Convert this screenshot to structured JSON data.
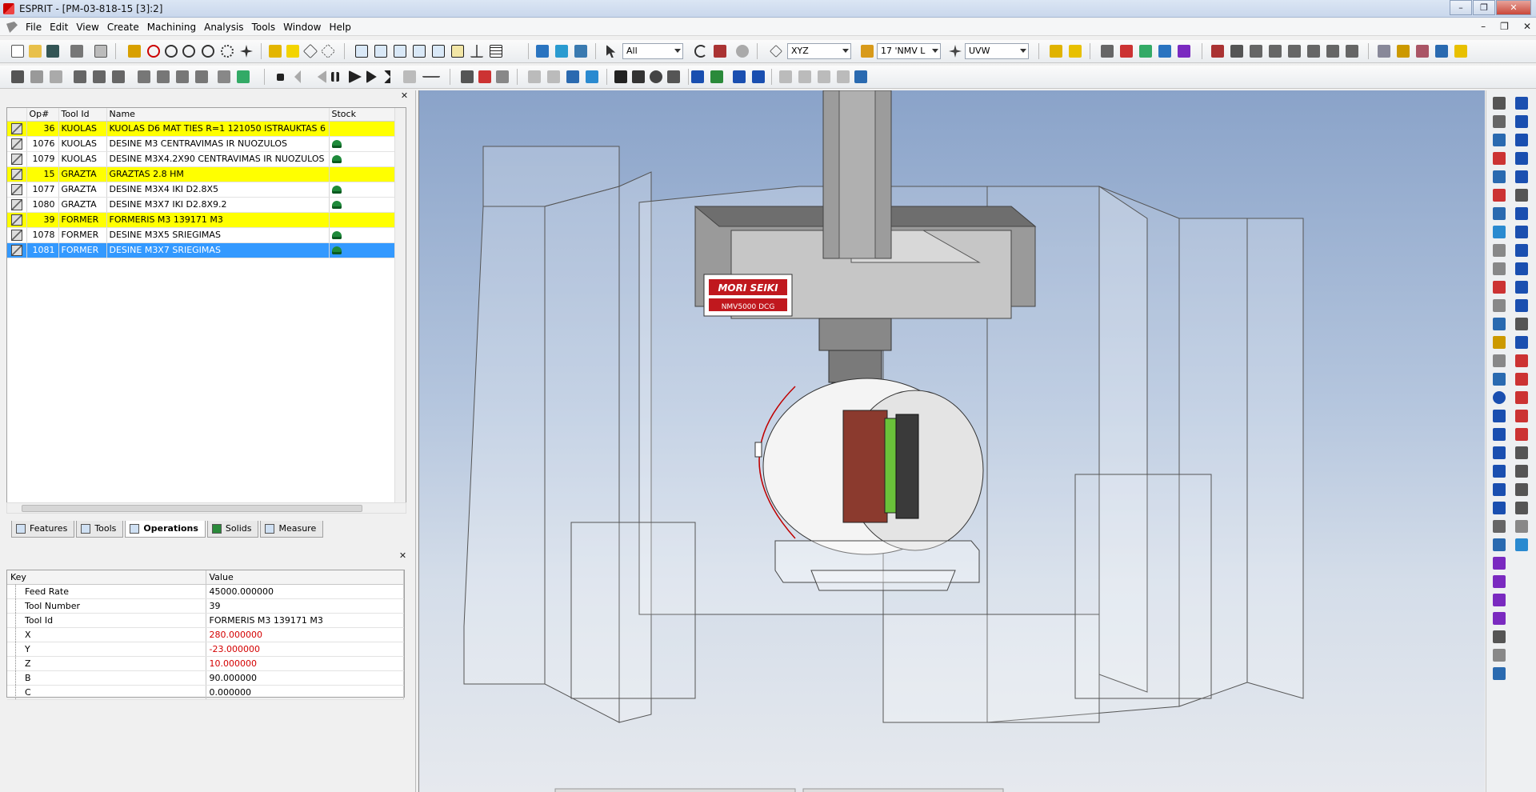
{
  "window": {
    "title": "ESPRIT - [PM-03-818-15 [3]:2]"
  },
  "menu": {
    "items": [
      "File",
      "Edit",
      "View",
      "Create",
      "Machining",
      "Analysis",
      "Tools",
      "Window",
      "Help"
    ]
  },
  "toolbar": {
    "select_filter": "All",
    "coordinate_system": "XYZ",
    "work_plane": "17 'NMV L",
    "uvw": "UVW"
  },
  "operations": {
    "columns": [
      "Op#",
      "Tool Id",
      "Name",
      "Stock"
    ],
    "rows": [
      {
        "op": "36",
        "tool": "KUOLAS",
        "name": "KUOLAS D6 MAT TIES R=1 121050 ISTRAUKTAS 6",
        "stock": false,
        "state": "highlight"
      },
      {
        "op": "1076",
        "tool": "KUOLAS",
        "name": "DESINE M3 CENTRAVIMAS IR NUOZULOS",
        "stock": true,
        "state": "normal"
      },
      {
        "op": "1079",
        "tool": "KUOLAS",
        "name": "DESINE M3X4.2X90 CENTRAVIMAS IR NUOZULOS",
        "stock": true,
        "state": "normal"
      },
      {
        "op": "15",
        "tool": "GRAZTA",
        "name": "GRAZTAS   2.8 HM",
        "stock": false,
        "state": "highlight"
      },
      {
        "op": "1077",
        "tool": "GRAZTA",
        "name": "DESINE M3X4 IKI D2.8X5",
        "stock": true,
        "state": "normal"
      },
      {
        "op": "1080",
        "tool": "GRAZTA",
        "name": "DESINE M3X7 IKI D2.8X9.2",
        "stock": true,
        "state": "normal"
      },
      {
        "op": "39",
        "tool": "FORMER",
        "name": "FORMERIS   M3 139171 M3",
        "stock": false,
        "state": "highlight"
      },
      {
        "op": "1078",
        "tool": "FORMER",
        "name": "DESINE M3X5 SRIEGIMAS",
        "stock": true,
        "state": "normal"
      },
      {
        "op": "1081",
        "tool": "FORMER",
        "name": "DESINE M3X7 SRIEGIMAS",
        "stock": true,
        "state": "selected"
      }
    ]
  },
  "tabs": [
    "Features",
    "Tools",
    "Operations",
    "Solids",
    "Measure"
  ],
  "active_tab": "Operations",
  "properties": {
    "columns": [
      "Key",
      "Value"
    ],
    "rows": [
      {
        "key": "Feed Rate",
        "value": "45000.000000",
        "changed": false
      },
      {
        "key": "Tool Number",
        "value": "39",
        "changed": false
      },
      {
        "key": "Tool Id",
        "value": "FORMERIS   M3 139171 M3",
        "changed": false
      },
      {
        "key": "X",
        "value": "280.000000",
        "changed": true
      },
      {
        "key": "Y",
        "value": "-23.000000",
        "changed": true
      },
      {
        "key": "Z",
        "value": "10.000000",
        "changed": true
      },
      {
        "key": "B",
        "value": "90.000000",
        "changed": false
      },
      {
        "key": "C",
        "value": "0.000000",
        "changed": false
      }
    ]
  },
  "viewport": {
    "machine_logo": "MORI SEIKI",
    "machine_model": "NMV5000 DCG"
  },
  "colors": {
    "highlight_row": "#ffff00",
    "selected_row": "#3399ff",
    "changed_value": "#d40000",
    "viewport_top": "#8aa3c9",
    "viewport_bottom": "#e6e9ee"
  }
}
